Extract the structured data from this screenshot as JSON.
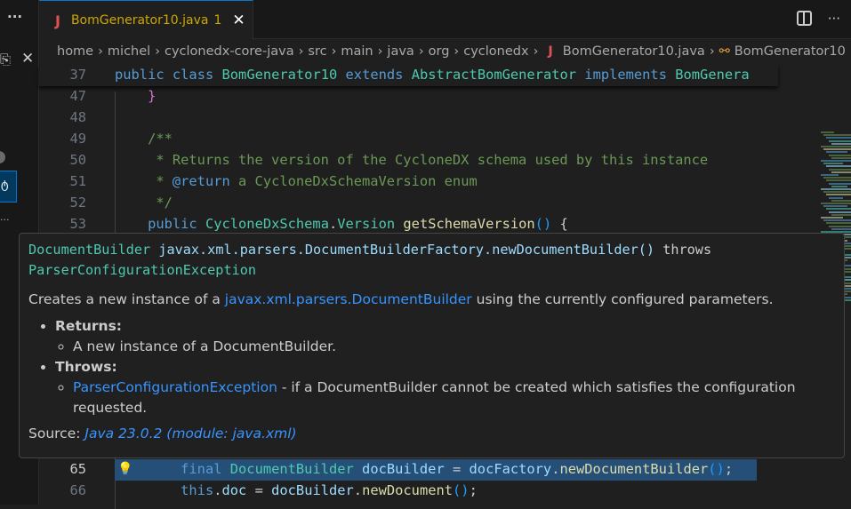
{
  "sidebar": {
    "more_label": "···",
    "ellipsis": "..."
  },
  "tab": {
    "icon": "J",
    "name": "BomGenerator10.java",
    "problems": "1",
    "close": "✕"
  },
  "tab_actions": {
    "more": "···"
  },
  "breadcrumb": [
    "home",
    "michel",
    "cyclonedx-core-java",
    "src",
    "main",
    "java",
    "org",
    "cyclonedx",
    "BomGenerator10.java",
    "BomGenerator10"
  ],
  "code": {
    "sticky": {
      "num": "37",
      "text": "public class BomGenerator10 extends AbstractBomGenerator implements BomGenera"
    },
    "lines": [
      {
        "num": "47",
        "text": "    }"
      },
      {
        "num": "48",
        "text": ""
      },
      {
        "num": "49",
        "text": "    /**"
      },
      {
        "num": "50",
        "text": "     * Returns the version of the CycloneDX schema used by this instance"
      },
      {
        "num": "51",
        "text": "     * @return a CycloneDxSchemaVersion enum"
      },
      {
        "num": "52",
        "text": "     */"
      },
      {
        "num": "53",
        "text": "    public CycloneDxSchema.Version getSchemaVersion() {"
      },
      {
        "num": "65",
        "text": "        final DocumentBuilder docBuilder = docFactory.newDocumentBuilder();"
      },
      {
        "num": "66",
        "text": "        this.doc = docBuilder.newDocument();"
      }
    ]
  },
  "hover": {
    "return_type": "DocumentBuilder",
    "signature": "javax.xml.parsers.DocumentBuilderFactory.newDocumentBuilder()",
    "throws_kw": "throws",
    "exception": "ParserConfigurationException",
    "desc_prefix": "Creates a new instance of a ",
    "desc_link": "javax.xml.parsers.DocumentBuilder",
    "desc_suffix": " using the currently configured parameters.",
    "returns_label": "Returns:",
    "returns_text": "A new instance of a DocumentBuilder.",
    "throws_label": "Throws:",
    "throws_link": "ParserConfigurationException",
    "throws_text": " - if a DocumentBuilder cannot be created which satisfies the configuration requested.",
    "source_label": "Source: ",
    "source_value": "Java 23.0.2 (module: java.xml)"
  }
}
